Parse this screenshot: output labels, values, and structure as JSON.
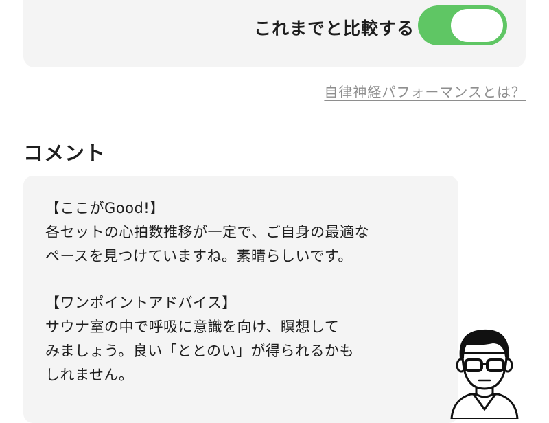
{
  "compare": {
    "label": "これまでと比較する",
    "toggle_on": true,
    "on_color": "#5fc664"
  },
  "help_link": "自律神経パフォーマンスとは？",
  "comment": {
    "title": "コメント",
    "good_heading": "【ここがGood!】",
    "good_lines": [
      "各セットの心拍数推移が一定で、ご自身の最適な",
      "ペースを見つけていますね。素晴らしいです。"
    ],
    "advice_heading": "【ワンポイントアドバイス】",
    "advice_lines": [
      "サウナ室の中で呼吸に意識を向け、瞑想して",
      "みましょう。良い「ととのい」が得られるかも",
      "しれません。"
    ]
  },
  "advisor": {
    "icon": "advisor-avatar-icon"
  }
}
